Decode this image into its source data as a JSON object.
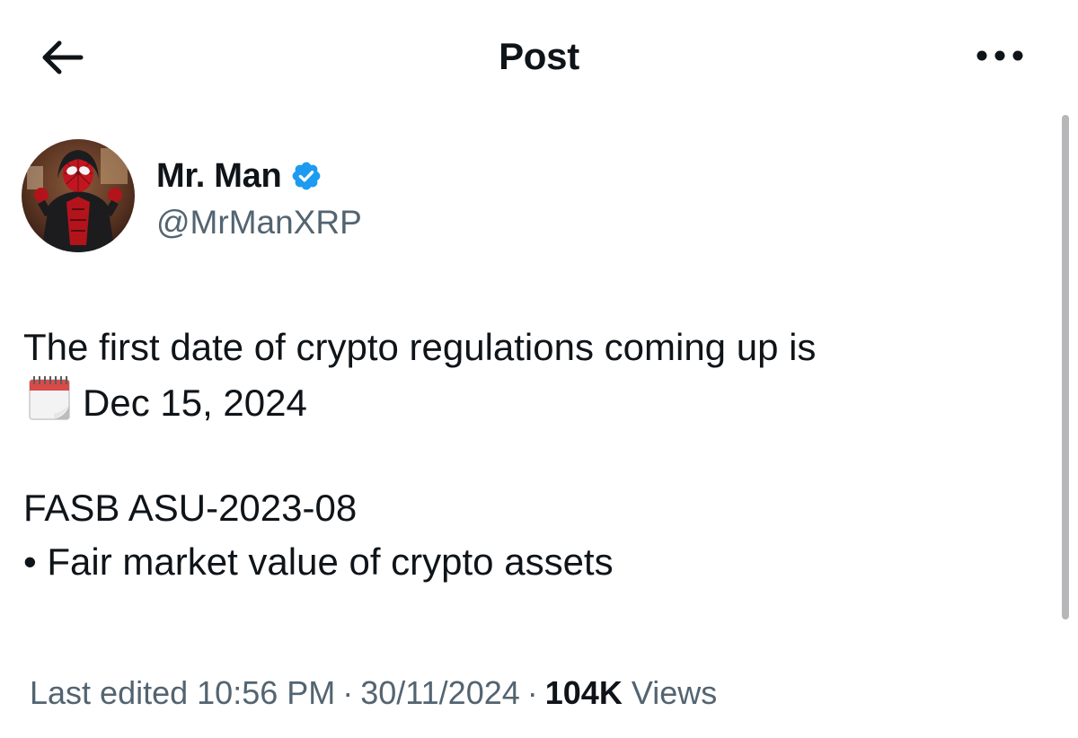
{
  "header": {
    "title": "Post",
    "back_icon": "arrow-left-icon",
    "more_icon": "more-horizontal-icon"
  },
  "author": {
    "display_name": "Mr. Man",
    "handle": "@MrManXRP",
    "verified": true,
    "verified_color": "#1d9bf0",
    "avatar_icon": "avatar-spiderman-photo"
  },
  "post": {
    "line1": "The first date of crypto regulations coming up is",
    "line2_icon": "spiral-calendar-icon",
    "line2_text": "Dec 15, 2024",
    "line3": "FASB ASU-2023-08",
    "line4": "• Fair market value of crypto assets"
  },
  "meta": {
    "edited_label": "Last edited",
    "time": "10:56 PM",
    "separator": "·",
    "date": "30/11/2024",
    "views_count": "104K",
    "views_label": "Views"
  },
  "colors": {
    "text_primary": "#0f1419",
    "text_secondary": "#536471",
    "accent": "#1d9bf0",
    "background": "#ffffff"
  }
}
